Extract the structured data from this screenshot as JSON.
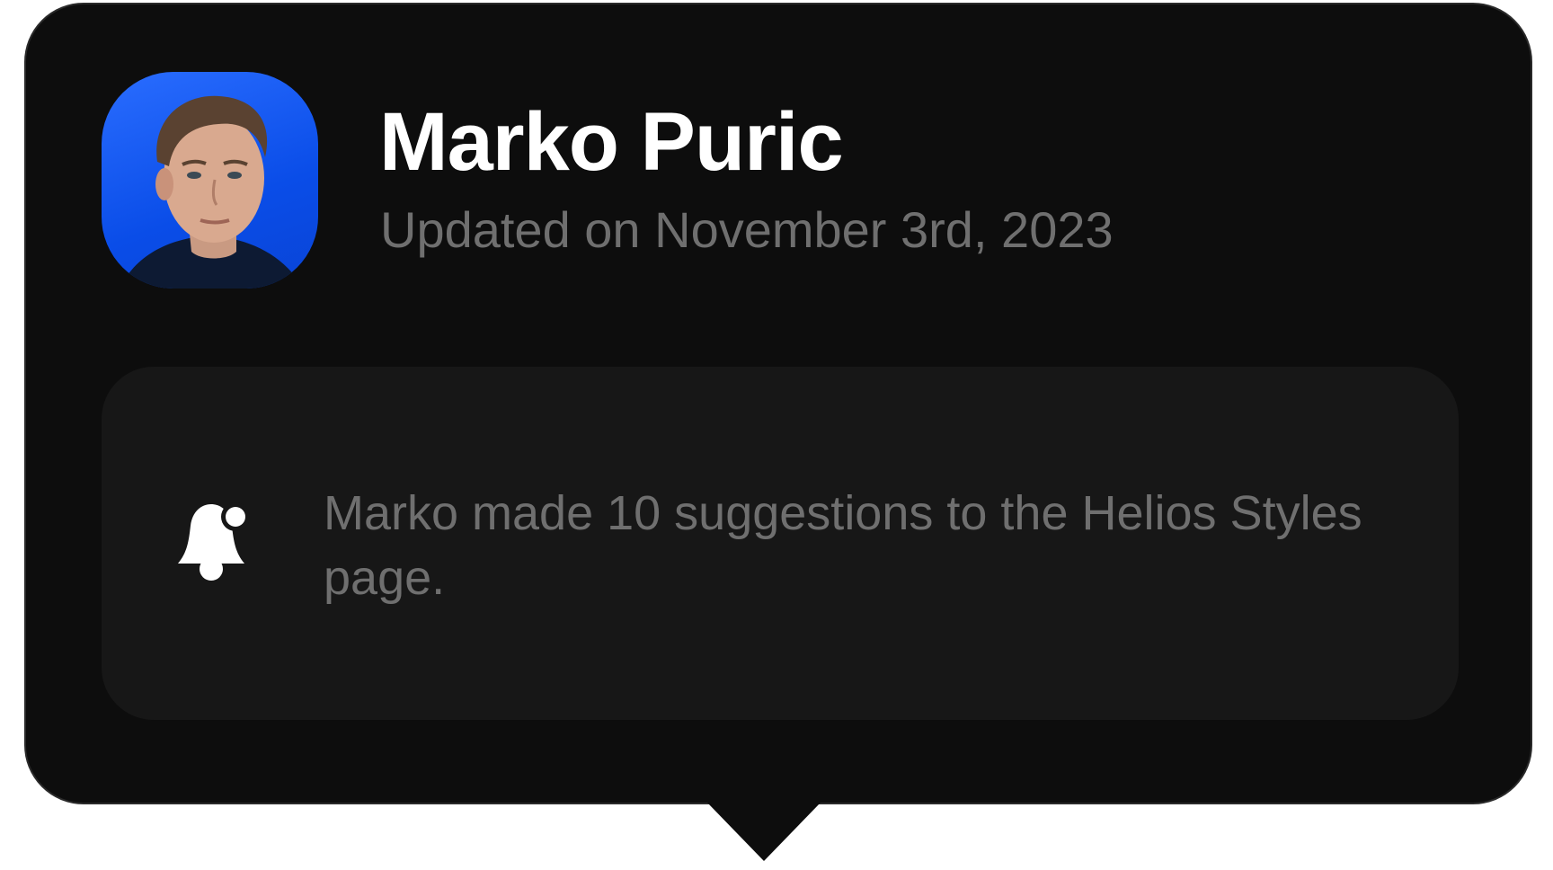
{
  "user": {
    "name": "Marko Puric",
    "updated_text": "Updated on November 3rd, 2023",
    "avatar_icon": "person-avatar"
  },
  "notification": {
    "icon": "bell-icon",
    "message": "Marko made 10 suggestions to the Helios Styles page."
  },
  "colors": {
    "background": "#0d0d0d",
    "card": "#171717",
    "avatar_bg": "#0a4de8",
    "title": "#ffffff",
    "muted": "#6f6f6f"
  }
}
